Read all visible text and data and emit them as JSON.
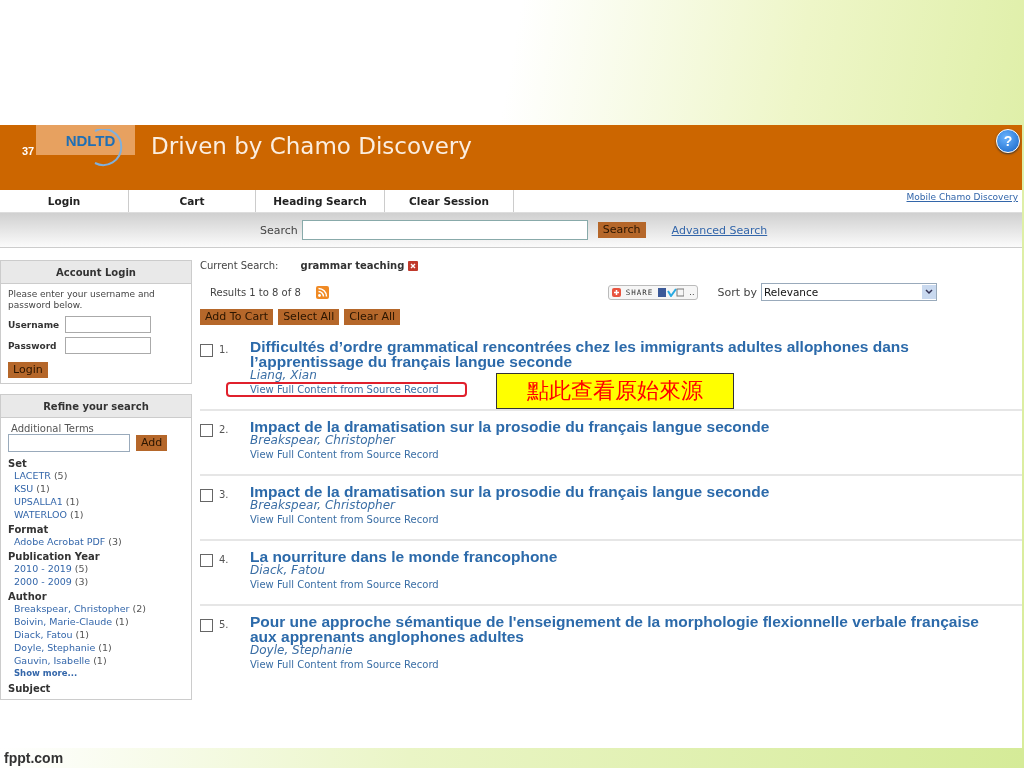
{
  "slide": {
    "number": "37",
    "footer": "fppt.com"
  },
  "header": {
    "logo": "NDLTD",
    "title": "Driven by Chamo Discovery",
    "help": "?"
  },
  "nav": {
    "items": [
      "Login",
      "Cart",
      "Heading Search",
      "Clear Session"
    ],
    "mobile_link": "Mobile Chamo Discovery"
  },
  "search_bar": {
    "label": "Search",
    "button": "Search",
    "advanced_link": "Advanced Search"
  },
  "sidebar": {
    "login": {
      "title": "Account Login",
      "intro": "Please enter your username and password below.",
      "username_label": "Username",
      "password_label": "Password",
      "button": "Login"
    },
    "refine": {
      "title": "Refine your search",
      "terms_label": "Additional Terms",
      "add_button": "Add",
      "facets": [
        {
          "heading": "Set",
          "items": [
            {
              "label": "LACETR",
              "count": "(5)"
            },
            {
              "label": "KSU",
              "count": "(1)"
            },
            {
              "label": "UPSALLA1",
              "count": "(1)"
            },
            {
              "label": "WATERLOO",
              "count": "(1)"
            }
          ]
        },
        {
          "heading": "Format",
          "items": [
            {
              "label": "Adobe Acrobat PDF",
              "count": "(3)"
            }
          ]
        },
        {
          "heading": "Publication Year",
          "items": [
            {
              "label": "2010 - 2019",
              "count": "(5)"
            },
            {
              "label": "2000 - 2009",
              "count": "(3)"
            }
          ]
        },
        {
          "heading": "Author",
          "items": [
            {
              "label": "Breakspear, Christopher",
              "count": "(2)"
            },
            {
              "label": "Boivin, Marie-Claude",
              "count": "(1)"
            },
            {
              "label": "Diack, Fatou",
              "count": "(1)"
            },
            {
              "label": "Doyle, Stephanie",
              "count": "(1)"
            },
            {
              "label": "Gauvin, Isabelle",
              "count": "(1)"
            }
          ],
          "more": "Show more..."
        },
        {
          "heading": "Subject"
        }
      ]
    }
  },
  "current_search": {
    "label": "Current Search:",
    "term": "grammar teaching"
  },
  "results_info": {
    "count": "Results 1 to 8 of 8",
    "share": "SHARE",
    "share_more": "..",
    "sort_label": "Sort by",
    "sort_value": "Relevance"
  },
  "actions": [
    "Add To Cart",
    "Select All",
    "Clear All"
  ],
  "results": [
    {
      "number": "1.",
      "checked": false,
      "title": "Difficultés d’ordre grammatical rencontrées chez les immigrants adultes allophones dans l’apprentissage du français langue seconde",
      "author": "Liang, Xian",
      "link": "View Full Content from Source Record",
      "highlighted": true
    },
    {
      "number": "2.",
      "checked": false,
      "title": "Impact de la dramatisation sur la prosodie du français langue seconde",
      "author": "Breakspear, Christopher",
      "link": "View Full Content from Source Record",
      "highlighted": false
    },
    {
      "number": "3.",
      "checked": false,
      "title": "Impact de la dramatisation sur la prosodie du français langue seconde",
      "author": "Breakspear, Christopher",
      "link": "View Full Content from Source Record",
      "highlighted": false
    },
    {
      "number": "4.",
      "checked": false,
      "title": "La nourriture dans le monde francophone",
      "author": "Diack, Fatou",
      "link": "View Full Content from Source Record",
      "highlighted": false
    },
    {
      "number": "5.",
      "checked": false,
      "title": "Pour une approche sémantique de l'enseignement de la morphologie flexionnelle verbale française aux apprenants anglophones adultes",
      "author": "Doyle, Stephanie",
      "link": "View Full Content from Source Record",
      "highlighted": false
    }
  ],
  "annotation": {
    "callout": "點此查看原始來源"
  }
}
